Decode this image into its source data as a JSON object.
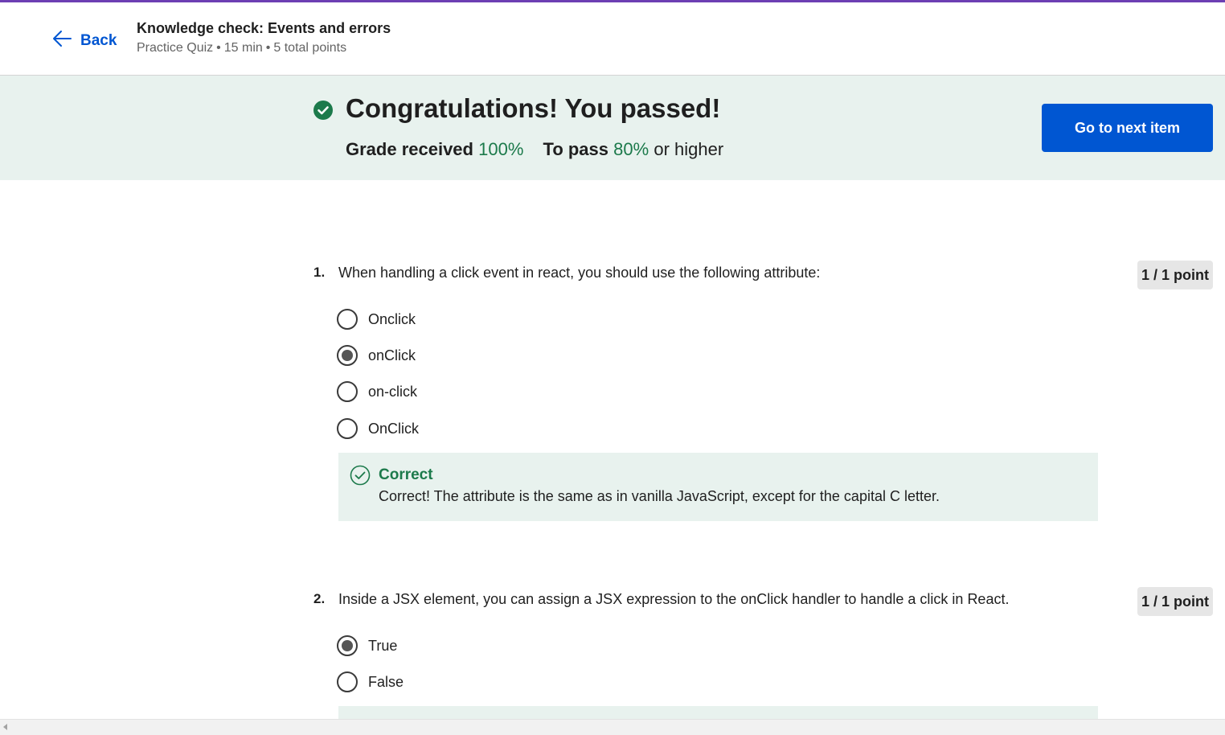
{
  "header": {
    "back_label": "Back",
    "title": "Knowledge check: Events and errors",
    "subtitle_type": "Practice Quiz",
    "subtitle_duration": "15 min",
    "subtitle_points": "5 total points",
    "separator": "•"
  },
  "banner": {
    "title": "Congratulations! You passed!",
    "grade_label": "Grade received",
    "grade_value": "100%",
    "pass_label": "To pass",
    "pass_value": "80%",
    "pass_suffix": "or higher",
    "next_button": "Go to next item"
  },
  "questions": [
    {
      "number": "1.",
      "text": "When handling a click event in react, you should use the following attribute:",
      "points": "1 / 1 point",
      "options": [
        {
          "label": "Onclick",
          "selected": false
        },
        {
          "label": "onClick",
          "selected": true
        },
        {
          "label": "on-click",
          "selected": false
        },
        {
          "label": "OnClick",
          "selected": false
        }
      ],
      "feedback": {
        "title": "Correct",
        "text": "Correct! The attribute is the same as in vanilla JavaScript, except for the capital C letter."
      }
    },
    {
      "number": "2.",
      "text": "Inside a JSX element, you can assign a JSX expression to the onClick handler to handle a click in React.",
      "points": "1 / 1 point",
      "options": [
        {
          "label": "True",
          "selected": true
        },
        {
          "label": "False",
          "selected": false
        }
      ]
    }
  ],
  "colors": {
    "accent": "#0056d2",
    "success": "#1c7a4b",
    "banner_bg": "#e8f2ee",
    "top_bar": "#6d3fb3"
  }
}
